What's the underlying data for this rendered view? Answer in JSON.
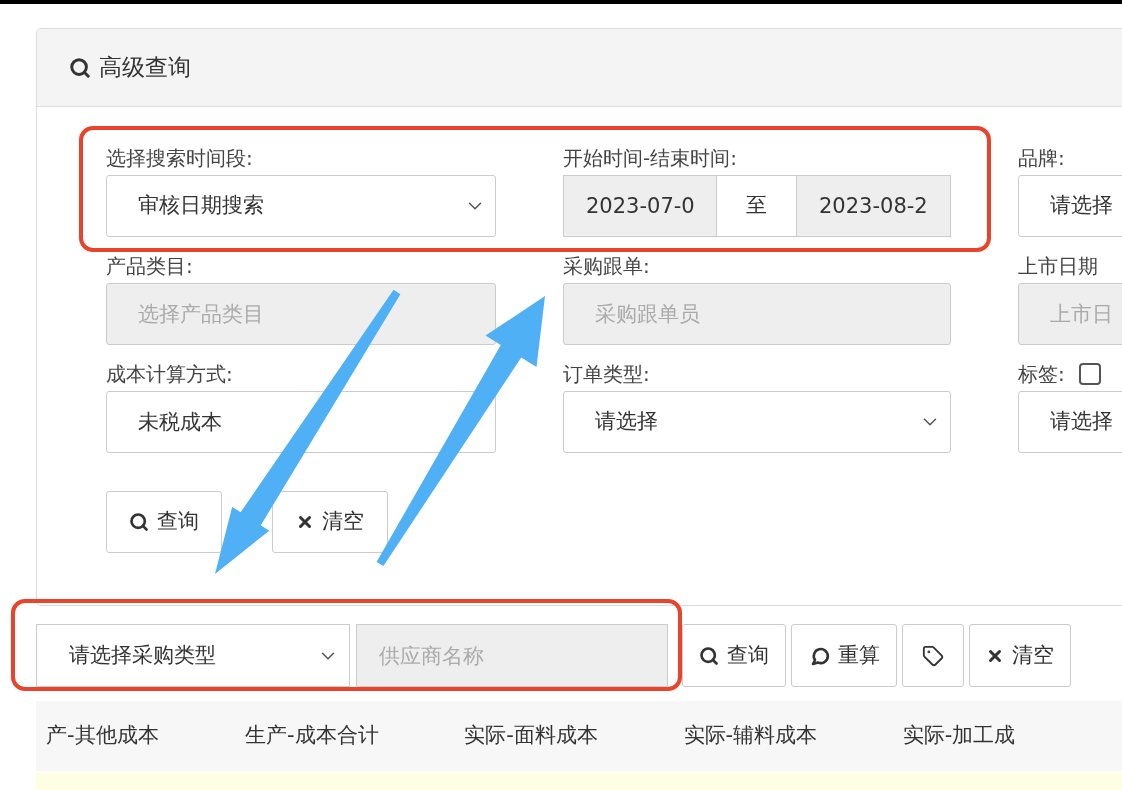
{
  "panel": {
    "title": "高级查询"
  },
  "fields": [
    {
      "label": "选择搜索时间段:",
      "kind": "select",
      "value": "审核日期搜索"
    },
    {
      "label": "开始时间-结束时间:",
      "kind": "daterange",
      "start": "2023-07-0",
      "separator": "至",
      "end": "2023-08-2"
    },
    {
      "label": "品牌:",
      "kind": "select",
      "value": "请选择"
    },
    {
      "label": "产品类目:",
      "kind": "text",
      "placeholder": "选择产品类目",
      "disabled": true
    },
    {
      "label": "采购跟单:",
      "kind": "text",
      "placeholder": "采购跟单员",
      "disabled": true
    },
    {
      "label": "上市日期",
      "kind": "text",
      "placeholder": "上市日",
      "disabled": true
    },
    {
      "label": "成本计算方式:",
      "kind": "text",
      "value": "未税成本",
      "disabled": false
    },
    {
      "label": "订单类型:",
      "kind": "select",
      "value": "请选择"
    },
    {
      "label": "标签:",
      "kind": "select",
      "value": "请选择",
      "checked": false
    }
  ],
  "buttons": [
    {
      "kind": "search",
      "label": "查询"
    },
    {
      "kind": "clear",
      "label": "清空"
    }
  ],
  "toolbar": {
    "select": "请选择采购类型",
    "input": {
      "placeholder": "供应商名称",
      "disabled": true
    },
    "buttons": [
      {
        "kind": "search",
        "label": "查询"
      },
      {
        "kind": "recalc",
        "label": "重算"
      },
      {
        "kind": "tag"
      },
      {
        "kind": "clear",
        "label": "清空"
      }
    ]
  },
  "table": {
    "columns": [
      "产-其他成本",
      "生产-成本合计",
      "实际-面料成本",
      "实际-辅料成本",
      "实际-加工成"
    ]
  }
}
